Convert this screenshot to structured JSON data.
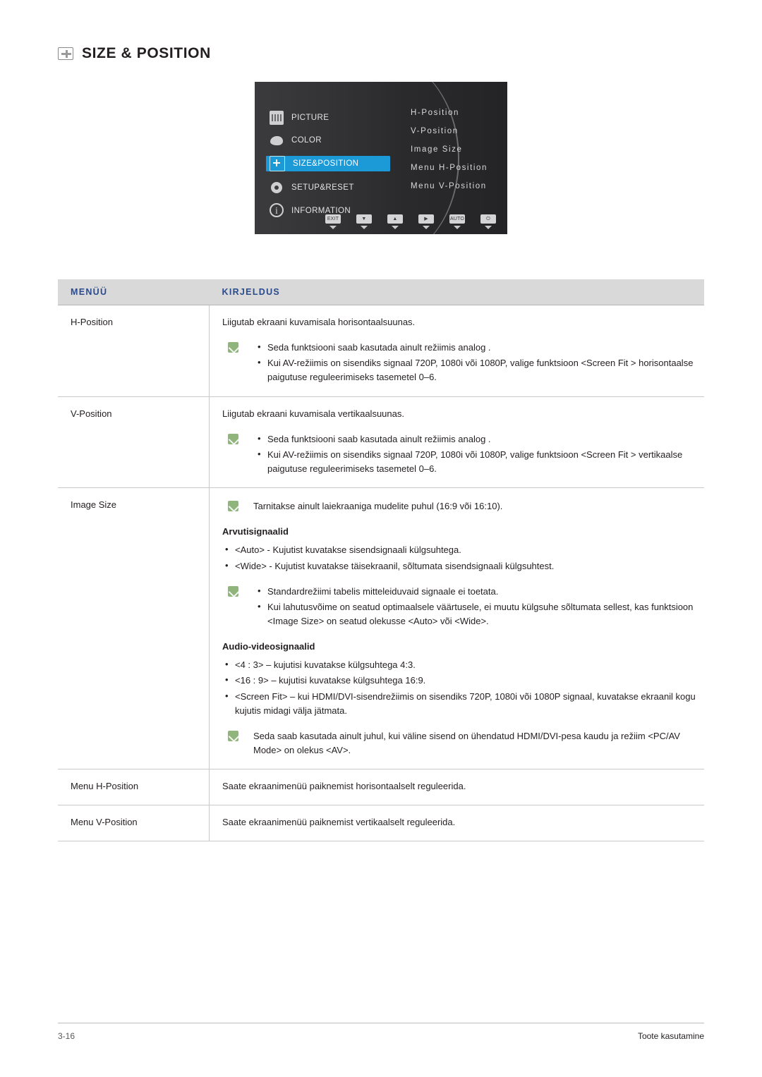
{
  "heading": {
    "title": "SIZE & POSITION",
    "icon": "size-position-icon"
  },
  "osd": {
    "left_menu": [
      {
        "label": "PICTURE",
        "icon": "picture-icon",
        "selected": false
      },
      {
        "label": "COLOR",
        "icon": "color-palette-icon",
        "selected": false
      },
      {
        "label": "SIZE&POSITION",
        "icon": "size-position-icon",
        "selected": true
      },
      {
        "label": "SETUP&RESET",
        "icon": "gear-icon",
        "selected": false
      },
      {
        "label": "INFORMATION",
        "icon": "info-icon",
        "selected": false
      }
    ],
    "right_items": [
      "H-Position",
      "V-Position",
      "Image Size",
      "Menu H-Position",
      "Menu V-Position"
    ],
    "buttons": [
      {
        "label": "EXIT",
        "icon": "exit-button"
      },
      {
        "label": "",
        "icon": "down-button"
      },
      {
        "label": "",
        "icon": "up-button"
      },
      {
        "label": "",
        "icon": "enter-button"
      },
      {
        "label": "AUTO",
        "icon": "auto-button"
      },
      {
        "label": "",
        "icon": "power-button"
      }
    ]
  },
  "table": {
    "headers": {
      "menu": "MENÜÜ",
      "description": "KIRJELDUS"
    },
    "rows": [
      {
        "menu": "H-Position",
        "intro": "Liigutab ekraani kuvamisala horisontaalsuunas.",
        "note": "Seda funktsiooni saab kasutada ainult režiimis analog .",
        "bullets": [
          "Kui AV-režiimis on sisendiks signaal 720P, 1080i või 1080P, valige funktsioon <Screen Fit > horisontaalse paigutuse reguleerimiseks tasemetel 0–6."
        ]
      },
      {
        "menu": "V-Position",
        "intro": "Liigutab ekraani kuvamisala vertikaalsuunas.",
        "note": "Seda funktsiooni saab kasutada ainult režiimis analog .",
        "bullets": [
          "Kui AV-režiimis on sisendiks signaal 720P, 1080i või 1080P, valige funktsioon <Screen Fit > vertikaalse paigutuse reguleerimiseks tasemetel 0–6."
        ]
      },
      {
        "menu": "Image Size",
        "note_top": "Tarnitakse ainult laiekraaniga mudelite puhul (16:9 või 16:10).",
        "sub1": "Arvutisignaalid",
        "sub1_bullets": [
          "<Auto> - Kujutist kuvatakse sisendsignaali külgsuhtega.",
          "<Wide> - Kujutist kuvatakse täisekraanil, sõltumata sisendsignaali külgsuhtest."
        ],
        "note_mid": "Standardrežiimi tabelis mitteleiduvaid signaale ei toetata.",
        "note_mid_bullets": [
          "Kui lahutusvõime on seatud optimaalsele väärtusele, ei muutu külgsuhe sõltumata sellest, kas funktsioon <Image Size> on seatud olekusse <Auto> või <Wide>."
        ],
        "sub2": "Audio-videosignaalid",
        "sub2_bullets": [
          "<4 : 3> – kujutisi kuvatakse külgsuhtega 4:3.",
          "<16 : 9> – kujutisi kuvatakse külgsuhtega 16:9.",
          "<Screen Fit> – kui HDMI/DVI-sisendrežiimis on sisendiks 720P, 1080i või 1080P signaal, kuvatakse ekraanil kogu kujutis midagi välja jätmata."
        ],
        "note_bottom": "Seda saab kasutada ainult juhul, kui väline sisend on ühendatud HDMI/DVI-pesa kaudu ja režiim <PC/AV Mode> on olekus <AV>."
      },
      {
        "menu": "Menu H-Position",
        "intro": "Saate ekraanimenüü paiknemist horisontaalselt reguleerida."
      },
      {
        "menu": "Menu V-Position",
        "intro": "Saate ekraanimenüü paiknemist vertikaalselt reguleerida."
      }
    ]
  },
  "footer": {
    "page_number": "3-16",
    "section": "Toote kasutamine"
  },
  "colors": {
    "header_bg": "#d9d9d9",
    "header_text": "#2a4b8d",
    "osd_highlight": "#1c9ad8",
    "note_badge": "#8fb47c"
  }
}
